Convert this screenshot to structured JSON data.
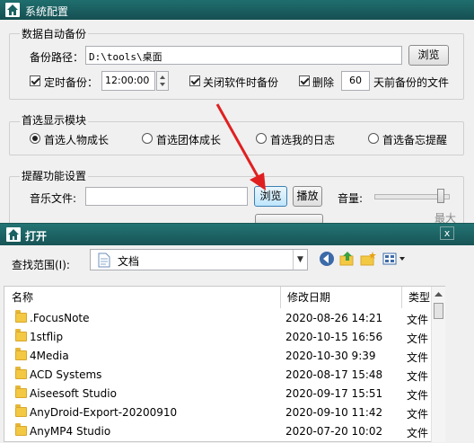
{
  "main_window": {
    "title": "系统配置",
    "backup": {
      "group_label": "数据自动备份",
      "path_label": "备份路径：",
      "path_value": "D:\\tools\\桌面",
      "browse_label": "浏览",
      "timed_label": "定时备份：",
      "time_value": "12:00:00",
      "close_backup_label": "关闭软件时备份",
      "delete_label": "删除",
      "days_value": "60",
      "days_suffix": "天前备份的文件"
    },
    "module": {
      "group_label": "首选显示模块",
      "options": [
        "首选人物成长",
        "首选团体成长",
        "首选我的日志",
        "首选备忘提醒"
      ],
      "selected_index": 0
    },
    "reminder": {
      "group_label": "提醒功能设置",
      "music_label": "音乐文件:",
      "music_value": "",
      "browse_label": "浏览",
      "play_label": "播放",
      "volume_label": "音量:",
      "volume_level": 0.95,
      "max_label": "最大"
    }
  },
  "open_dialog": {
    "title": "打开",
    "close_label": "x",
    "lookin_label": "查找范围(I):",
    "lookin_value": "文档",
    "columns": {
      "name": "名称",
      "date": "修改日期",
      "type": "类型"
    },
    "files": [
      {
        "name": ".FocusNote",
        "date": "2020-08-26 14:21",
        "type": "文件"
      },
      {
        "name": "1stflip",
        "date": "2020-10-15 16:56",
        "type": "文件"
      },
      {
        "name": "4Media",
        "date": "2020-10-30 9:39",
        "type": "文件"
      },
      {
        "name": "ACD Systems",
        "date": "2020-08-17 15:48",
        "type": "文件"
      },
      {
        "name": "Aiseesoft Studio",
        "date": "2020-09-17 15:51",
        "type": "文件"
      },
      {
        "name": "AnyDroid-Export-20200910",
        "date": "2020-09-10 11:42",
        "type": "文件"
      },
      {
        "name": "AnyMP4 Studio",
        "date": "2020-07-20 10:02",
        "type": "文件"
      }
    ]
  },
  "colors": {
    "titlebar": "#1b6262",
    "folder": "#f3c843",
    "arrow": "#e02020"
  }
}
